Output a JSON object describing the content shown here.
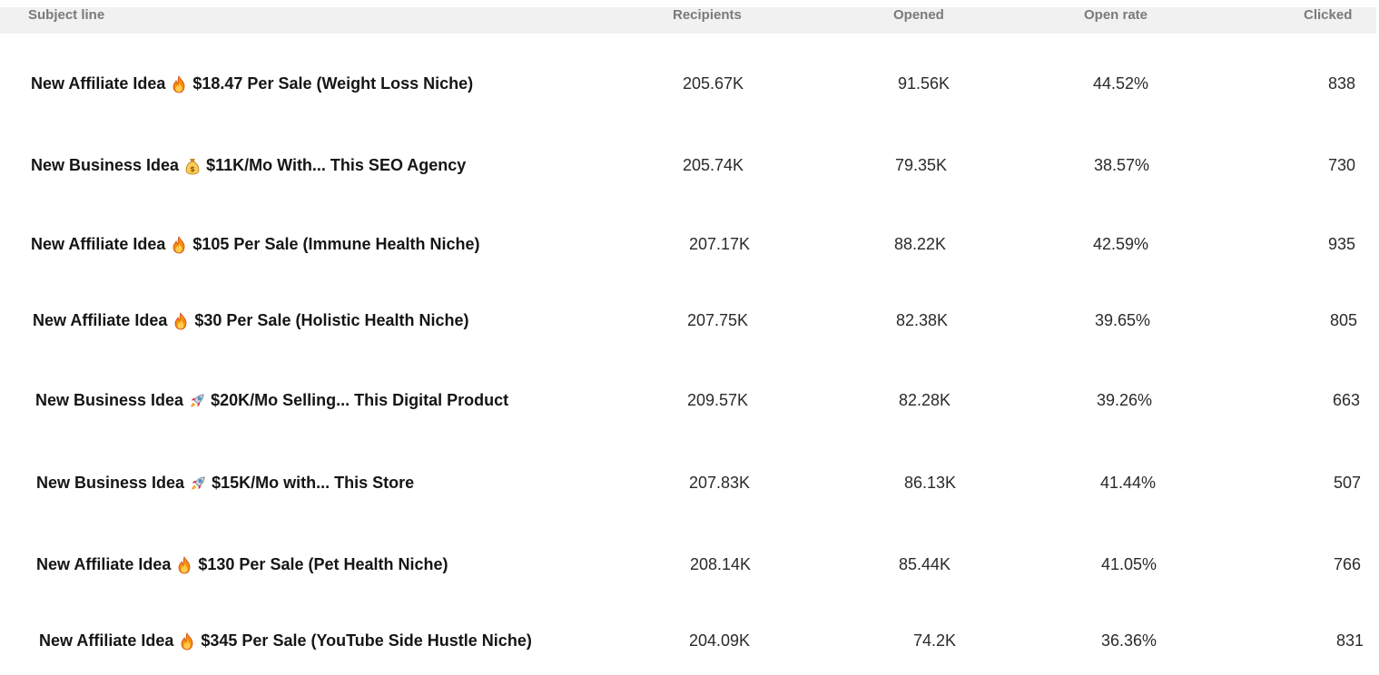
{
  "columns": {
    "subject": "Subject line",
    "recipients": "Recipients",
    "opened": "Opened",
    "open_rate": "Open rate",
    "clicked": "Clicked"
  },
  "rows": [
    {
      "prefix": "New Affiliate Idea",
      "emoji": "fire-icon",
      "suffix": "$18.47 Per Sale (Weight Loss Niche)",
      "recipients": "205.67K",
      "opened": "91.56K",
      "open_rate": "44.52%",
      "clicked": "838"
    },
    {
      "prefix": "New Business Idea",
      "emoji": "money-bag-icon",
      "suffix": "$11K/Mo With... This SEO Agency",
      "recipients": "205.74K",
      "opened": "79.35K",
      "open_rate": "38.57%",
      "clicked": "730"
    },
    {
      "prefix": "New Affiliate Idea",
      "emoji": "fire-icon",
      "suffix": "$105 Per Sale (Immune Health Niche)",
      "recipients": "207.17K",
      "opened": "88.22K",
      "open_rate": "42.59%",
      "clicked": "935"
    },
    {
      "prefix": "New Affiliate Idea",
      "emoji": "fire-icon",
      "suffix": "$30 Per Sale (Holistic Health Niche)",
      "recipients": "207.75K",
      "opened": "82.38K",
      "open_rate": "39.65%",
      "clicked": "805"
    },
    {
      "prefix": "New Business Idea",
      "emoji": "rocket-icon",
      "suffix": "$20K/Mo Selling... This Digital Product",
      "recipients": "209.57K",
      "opened": "82.28K",
      "open_rate": "39.26%",
      "clicked": "663"
    },
    {
      "prefix": "New Business Idea",
      "emoji": "rocket-icon",
      "suffix": "$15K/Mo with... This Store",
      "recipients": "207.83K",
      "opened": "86.13K",
      "open_rate": "41.44%",
      "clicked": "507"
    },
    {
      "prefix": "New Affiliate Idea",
      "emoji": "fire-icon",
      "suffix": "$130 Per Sale (Pet Health Niche)",
      "recipients": "208.14K",
      "opened": "85.44K",
      "open_rate": "41.05%",
      "clicked": "766"
    },
    {
      "prefix": "New Affiliate Idea",
      "emoji": "fire-icon",
      "suffix": "$345 Per Sale (YouTube Side Hustle Niche)",
      "recipients": "204.09K",
      "opened": "74.2K",
      "open_rate": "36.36%",
      "clicked": "831"
    }
  ],
  "colors": {
    "header_bg": "#f1f1f1",
    "header_text": "#7a7a7a",
    "row_text": "#2a2a2a"
  }
}
